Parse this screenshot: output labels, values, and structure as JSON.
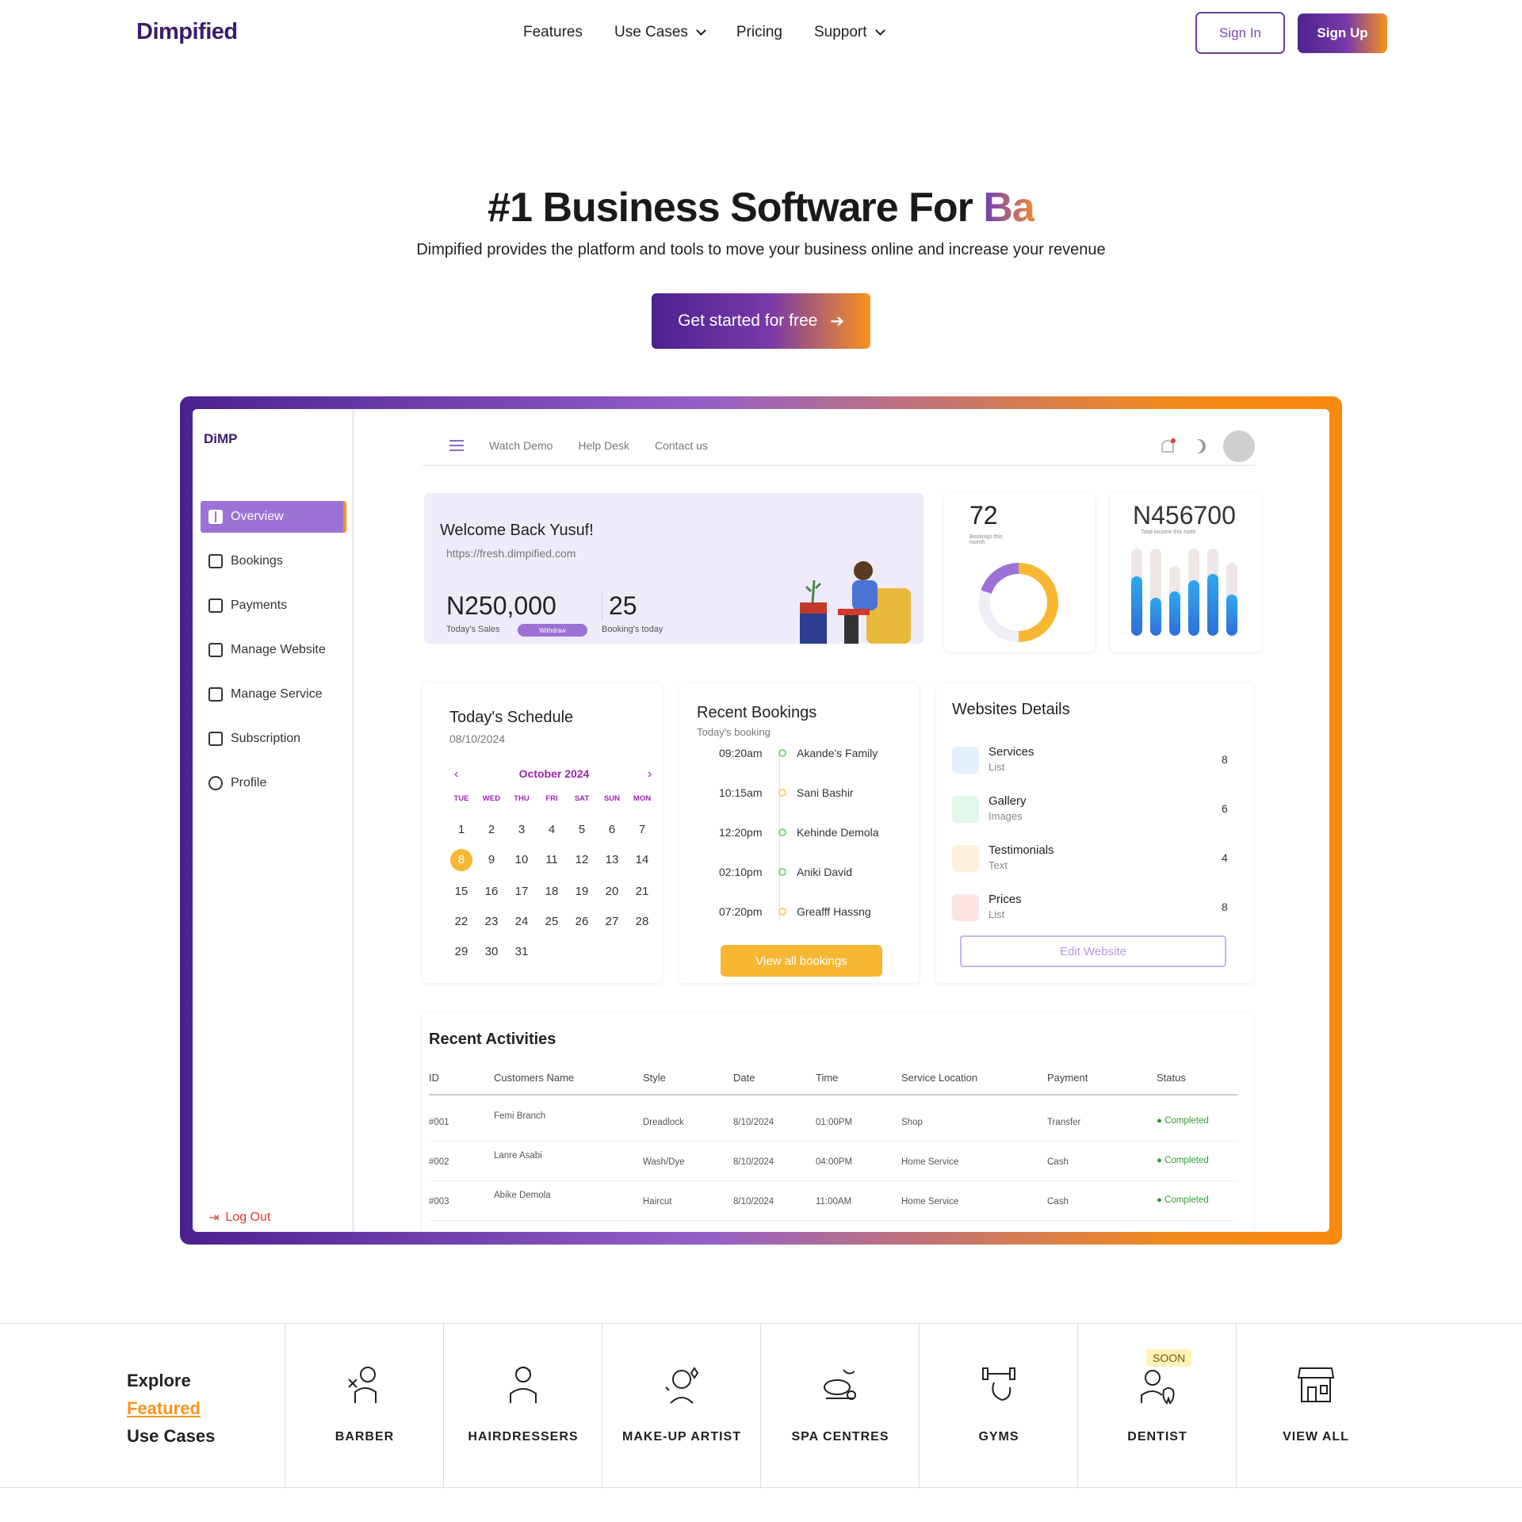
{
  "nav": {
    "logo": "Dimpified",
    "menu": [
      "Features",
      "Use Cases",
      "Pricing",
      "Support"
    ],
    "sign_in": "Sign In",
    "sign_up": "Sign Up"
  },
  "hero": {
    "title_main": "#1 Business Software For ",
    "title_accent": "Ba",
    "subtitle": "Dimpified provides the platform and tools to move your business online and increase your revenue",
    "cta": "Get started for free"
  },
  "dashboard": {
    "brand": "DiMP",
    "sidebar": [
      "Overview",
      "Bookings",
      "Payments",
      "Manage Website",
      "Manage Service",
      "Subscription",
      "Profile"
    ],
    "logout": "Log Out",
    "topbar": [
      "Watch Demo",
      "Help Desk",
      "Contact us"
    ],
    "welcome": {
      "title": "Welcome Back Yusuf!",
      "url": "https://fresh.dimpified.com",
      "sales": "N250,000",
      "sales_label": "Today's Sales",
      "withdraw": "Withdraw",
      "bookings": "25",
      "bookings_label": "Booking's today"
    },
    "stat_bookings": {
      "value": "72",
      "label": "Bookings this month"
    },
    "stat_income": {
      "value": "N456700",
      "label": "Total income this moth"
    },
    "schedule": {
      "title": "Today's Schedule",
      "date": "08/10/2024",
      "month": "October 2024",
      "weekdays": [
        "TUE",
        "WED",
        "THU",
        "FRI",
        "SAT",
        "SUN",
        "MON"
      ],
      "days": [
        "1",
        "2",
        "3",
        "4",
        "5",
        "6",
        "7",
        "8",
        "9",
        "10",
        "11",
        "12",
        "13",
        "14",
        "15",
        "16",
        "17",
        "18",
        "19",
        "20",
        "21",
        "22",
        "23",
        "24",
        "25",
        "26",
        "27",
        "28",
        "29",
        "30",
        "31"
      ],
      "selected": "8"
    },
    "recent_bookings": {
      "title": "Recent Bookings",
      "subtitle": "Today's booking",
      "items": [
        {
          "time": "09:20am",
          "name": "Akande's Family"
        },
        {
          "time": "10:15am",
          "name": "Sani Bashir"
        },
        {
          "time": "12:20pm",
          "name": "Kehinde Demola"
        },
        {
          "time": "02:10pm",
          "name": "Aniki David"
        },
        {
          "time": "07:20pm",
          "name": "Greafff Hassng"
        }
      ],
      "button": "View all bookings"
    },
    "website_details": {
      "title": "Websites Details",
      "rows": [
        {
          "name": "Services",
          "sub": "List",
          "count": "8",
          "color": "#2f8fe0"
        },
        {
          "name": "Gallery",
          "sub": "Images",
          "count": "6",
          "color": "#2eb86b"
        },
        {
          "name": "Testimonials",
          "sub": "Text",
          "count": "4",
          "color": "#f0a020"
        },
        {
          "name": "Prices",
          "sub": "List",
          "count": "8",
          "color": "#e53935"
        }
      ],
      "button": "Edit Website"
    },
    "activities": {
      "title": "Recent Activities",
      "headers": [
        "ID",
        "Customers Name",
        "Style",
        "Date",
        "Time",
        "Service Location",
        "Payment",
        "Status"
      ],
      "rows": [
        [
          "#001",
          "Femi Branch",
          "Dreadlock",
          "8/10/2024",
          "01:00PM",
          "Shop",
          "Transfer",
          "Completed"
        ],
        [
          "#002",
          "Lanre Asabi",
          "Wash/Dye",
          "8/10/2024",
          "04:00PM",
          "Home Service",
          "Cash",
          "Completed"
        ],
        [
          "#003",
          "Abike Demola",
          "Haircut",
          "8/10/2024",
          "11:00AM",
          "Home Service",
          "Cash",
          "Completed"
        ]
      ]
    }
  },
  "use_cases": {
    "intro": [
      "Explore",
      "Featured",
      "Use Cases"
    ],
    "items": [
      {
        "label": "BARBER",
        "icon": "barber-icon"
      },
      {
        "label": "HAIRDRESSERS",
        "icon": "hairdresser-icon"
      },
      {
        "label": "MAKE-UP ARTIST",
        "icon": "makeup-artist-icon"
      },
      {
        "label": "SPA CENTRES",
        "icon": "spa-icon"
      },
      {
        "label": "GYMS",
        "icon": "gym-icon"
      },
      {
        "label": "DENTIST",
        "icon": "dentist-icon",
        "badge": "SOON"
      },
      {
        "label": "VIEW ALL",
        "icon": "storefront-icon"
      }
    ]
  }
}
